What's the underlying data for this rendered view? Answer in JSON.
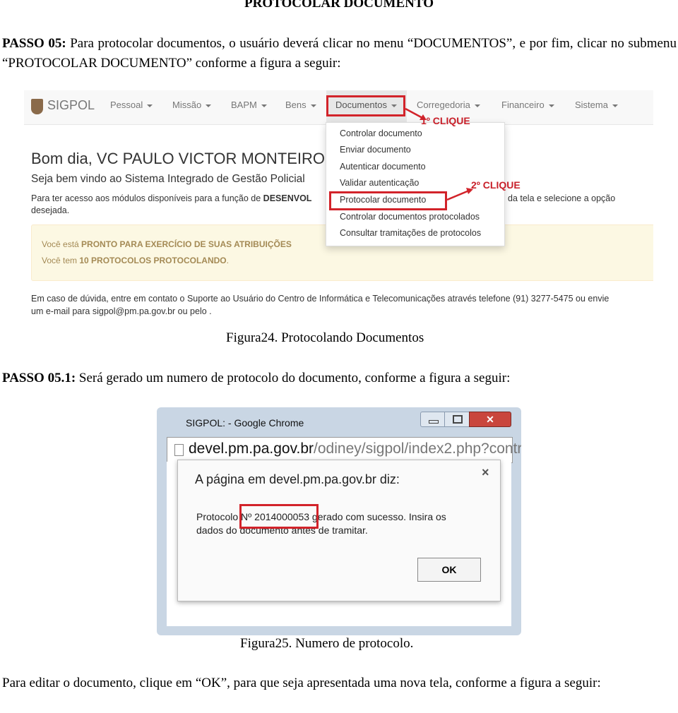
{
  "heading": "PROTOCOLAR DOCUMENTO",
  "step5": {
    "label": "PASSO 05:",
    "text": " Para protocolar documentos, o usuário deverá clicar no menu “DOCUMENTOS”, e por fim, clicar no submenu “PROTOCOLAR DOCUMENTO” conforme a figura a seguir:"
  },
  "figure24": {
    "caption": "Figura24. Protocolando Documentos",
    "navbar": {
      "brand": "SIGPOL",
      "items": [
        "Pessoal",
        "Missão",
        "BAPM",
        "Bens",
        "Documentos",
        "Corregedoria",
        "Financeiro",
        "Sistema"
      ]
    },
    "annotations": {
      "first_click": "1º CLIQUE",
      "second_click": "2º CLIQUE"
    },
    "dropdown": [
      "Controlar documento",
      "Enviar documento",
      "Autenticar documento",
      "Validar autenticação",
      "Protocolar documento",
      "Controlar documentos protocolados",
      "Consultar tramitações de protocolos"
    ],
    "greeting": "Bom dia, VC PAULO VICTOR MONTEIRO",
    "welcome": "Seja bem vindo ao Sistema Integrado de Gestão Policial",
    "intro_left": "Para ter acesso aos módulos disponíveis para a função de ",
    "intro_bold": "DESENVOL",
    "intro_right": "da tela e selecione a opção",
    "intro_line2": "desejada.",
    "alert": {
      "line1_prefix": "Você está ",
      "line1_bold": "PRONTO PARA EXERCÍCIO DE SUAS ATRIBUIÇÕES",
      "line2_prefix": "Você tem ",
      "line2_bold": "10 PROTOCOLOS PROTOCOLANDO",
      "line2_suffix": "."
    },
    "footer_line1": "Em caso de dúvida, entre em contato o Suporte ao Usuário do Centro de Informática e Telecomunicações através telefone (91) 3277-5475 ou envie",
    "footer_line2": "um e-mail para sigpol@pm.pa.gov.br ou pelo ."
  },
  "step51": {
    "label": "PASSO 05.1:",
    "text": " Será gerado um numero de protocolo do documento, conforme a figura a seguir:"
  },
  "figure25": {
    "caption": "Figura25. Numero de protocolo.",
    "window_title": "SIGPOL: - Google Chrome",
    "url_host": "devel.pm.pa.gov.br",
    "url_path": "/odiney/sigpol/index2.php?contr",
    "dialog_title": "A página em devel.pm.pa.gov.br diz:",
    "message_prefix": "Protocolo ",
    "protocol_number": "Nº 2014000053",
    "message_suffix": " gerado com sucesso. Insira os",
    "message_line2": "dados do documento antes de tramitar.",
    "ok_label": "OK",
    "colors": {
      "highlight": "#d2232a",
      "close_button": "#c9463d"
    }
  },
  "closing": "Para editar o documento, clique em “OK”, para que seja apresentada uma nova tela, conforme a figura a seguir:"
}
